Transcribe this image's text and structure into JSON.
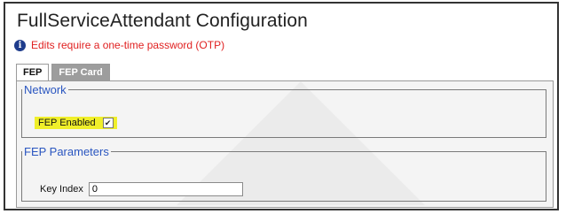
{
  "page": {
    "title": "FullServiceAttendant Configuration",
    "notice": "Edits require a one-time password (OTP)",
    "notice_icon": "info-icon",
    "notice_color": "#e02020"
  },
  "tabs": [
    {
      "label": "FEP",
      "active": true
    },
    {
      "label": "FEP Card",
      "active": false
    }
  ],
  "network": {
    "legend": "Network",
    "fep_enabled": {
      "label": "FEP Enabled",
      "checked": true,
      "highlight_color": "#f0ef2a"
    }
  },
  "fep_parameters": {
    "legend": "FEP Parameters",
    "key_index": {
      "label": "Key Index",
      "value": "0"
    }
  },
  "colors": {
    "legend": "#2a56c0",
    "inactive_tab": "#9d9d9d"
  }
}
